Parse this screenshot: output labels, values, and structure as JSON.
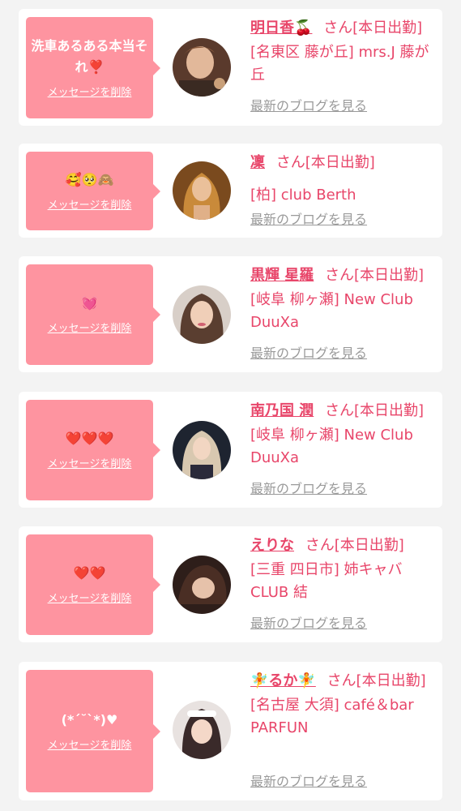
{
  "colors": {
    "accent": "#e8466a",
    "bubble": "#fe94a0",
    "background": "#f3f3f3",
    "link_gray": "#9a9a9a"
  },
  "entries": [
    {
      "message": "洗車あるある本当それ❣️",
      "delete_label": "メッセージを削除",
      "name": "明日香🍒",
      "suffix": "さん[本日出勤]",
      "shop": "[名東区 藤が丘] mrs.J 藤が丘",
      "blog_label": "最新のブログを見る"
    },
    {
      "message": "🥰🥺🙈",
      "delete_label": "メッセージを削除",
      "name": "凜",
      "suffix": "さん[本日出勤]",
      "shop": "[柏] club Berth",
      "blog_label": "最新のブログを見る"
    },
    {
      "message": "💓",
      "delete_label": "メッセージを削除",
      "name": "黒輝 星羅",
      "suffix": "さん[本日出勤]",
      "shop": "[岐阜 柳ヶ瀬] New Club DuuXa",
      "blog_label": "最新のブログを見る"
    },
    {
      "message": "❤️❤️❤️",
      "delete_label": "メッセージを削除",
      "name": "南乃国 潤",
      "suffix": "さん[本日出勤]",
      "shop": "[岐阜 柳ヶ瀬] New Club DuuXa",
      "blog_label": "最新のブログを見る"
    },
    {
      "message": "❤️❤️",
      "delete_label": "メッセージを削除",
      "name": "えりな",
      "suffix": "さん[本日出勤]",
      "shop": "[三重 四日市] 姉キャバ CLUB 結",
      "blog_label": "最新のブログを見る"
    },
    {
      "message": "(*´˘`*)♥",
      "delete_label": "メッセージを削除",
      "name": "🧚るか🧚",
      "suffix": "さん[本日出勤]",
      "shop": "[名古屋 大須] café＆bar PARFUN",
      "blog_label": "最新のブログを見る"
    }
  ]
}
